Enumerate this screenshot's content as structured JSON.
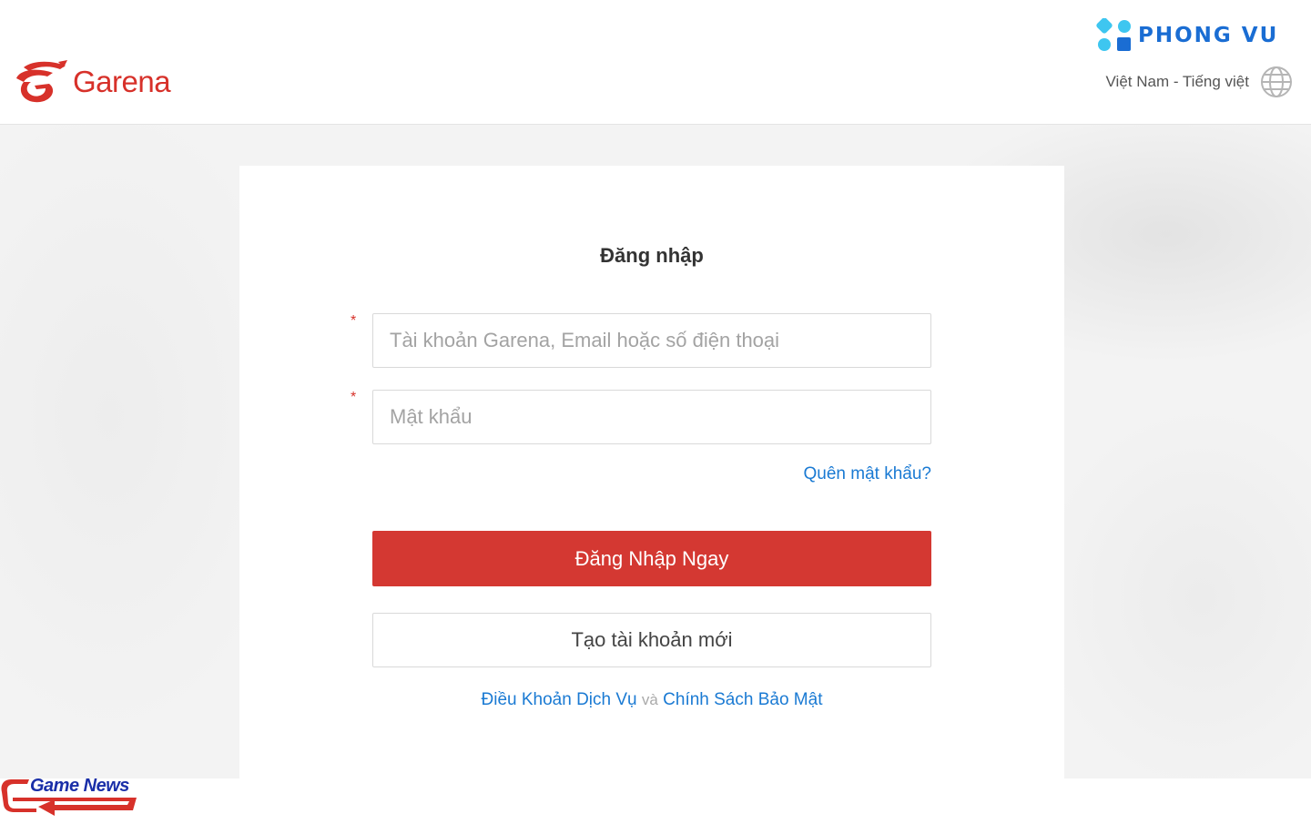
{
  "header": {
    "brand_name": "Garena",
    "partner_brand": "PHONG VU",
    "language_label": "Việt Nam - Tiếng việt"
  },
  "login": {
    "title": "Đăng nhập",
    "account_placeholder": "Tài khoản Garena, Email hoặc số điện thoại",
    "password_placeholder": "Mật khẩu",
    "required_marker": "*",
    "forgot_password": "Quên mật khẩu?",
    "login_button": "Đăng Nhập Ngay",
    "create_account_button": "Tạo tài khoản mới",
    "terms_link": "Điều Khoản Dịch Vụ",
    "and_text": "và",
    "privacy_link": "Chính Sách Bảo Mật"
  },
  "watermark": {
    "text": "Game News"
  },
  "colors": {
    "brand_red": "#d43832",
    "link_blue": "#1a7ad3",
    "phongvu_blue": "#1a6dd3",
    "phongvu_cyan": "#3ec6f0"
  }
}
